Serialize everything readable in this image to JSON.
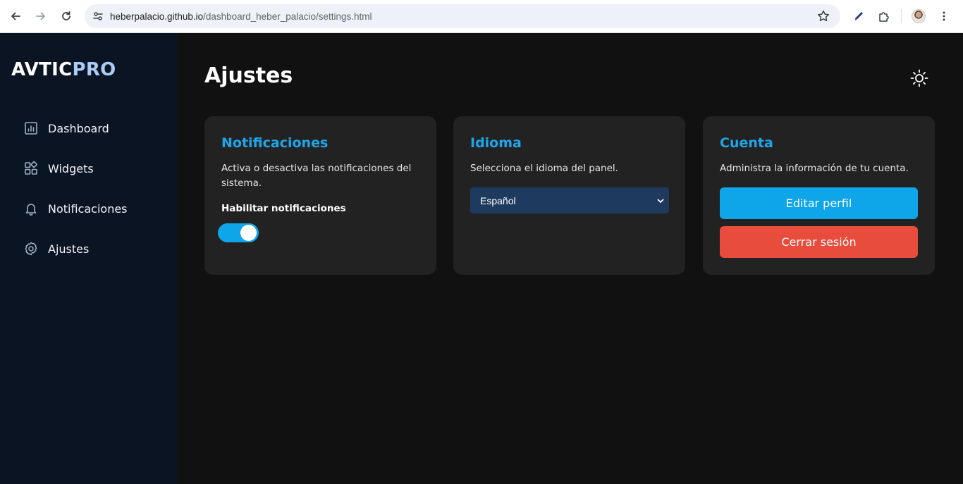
{
  "browser": {
    "url_host": "heberpalacio.github.io",
    "url_path": "/dashboard_heber_palacio/settings.html"
  },
  "sidebar": {
    "brand_primary": "AVTIC",
    "brand_accent": "PRO",
    "items": [
      {
        "label": "Dashboard",
        "icon": "bar-chart-icon"
      },
      {
        "label": "Widgets",
        "icon": "widgets-icon"
      },
      {
        "label": "Notificaciones",
        "icon": "bell-icon"
      },
      {
        "label": "Ajustes",
        "icon": "gear-icon"
      }
    ]
  },
  "main": {
    "title": "Ajustes",
    "theme_toggle_icon": "sun-icon"
  },
  "cards": {
    "notifications": {
      "title": "Notificaciones",
      "description": "Activa o desactiva las notificaciones del sistema.",
      "toggle_label": "Habilitar notificaciones",
      "toggle_on": true
    },
    "language": {
      "title": "Idioma",
      "description": "Selecciona el idioma del panel.",
      "selected": "Español"
    },
    "account": {
      "title": "Cuenta",
      "description": "Administra la información de tu cuenta.",
      "edit_label": "Editar perfil",
      "logout_label": "Cerrar sesión"
    }
  },
  "colors": {
    "accent": "#0ea5e9",
    "danger": "#e74c3c",
    "sidebar_bg": "#0b1423",
    "main_bg": "#111111",
    "card_bg": "#222222"
  }
}
